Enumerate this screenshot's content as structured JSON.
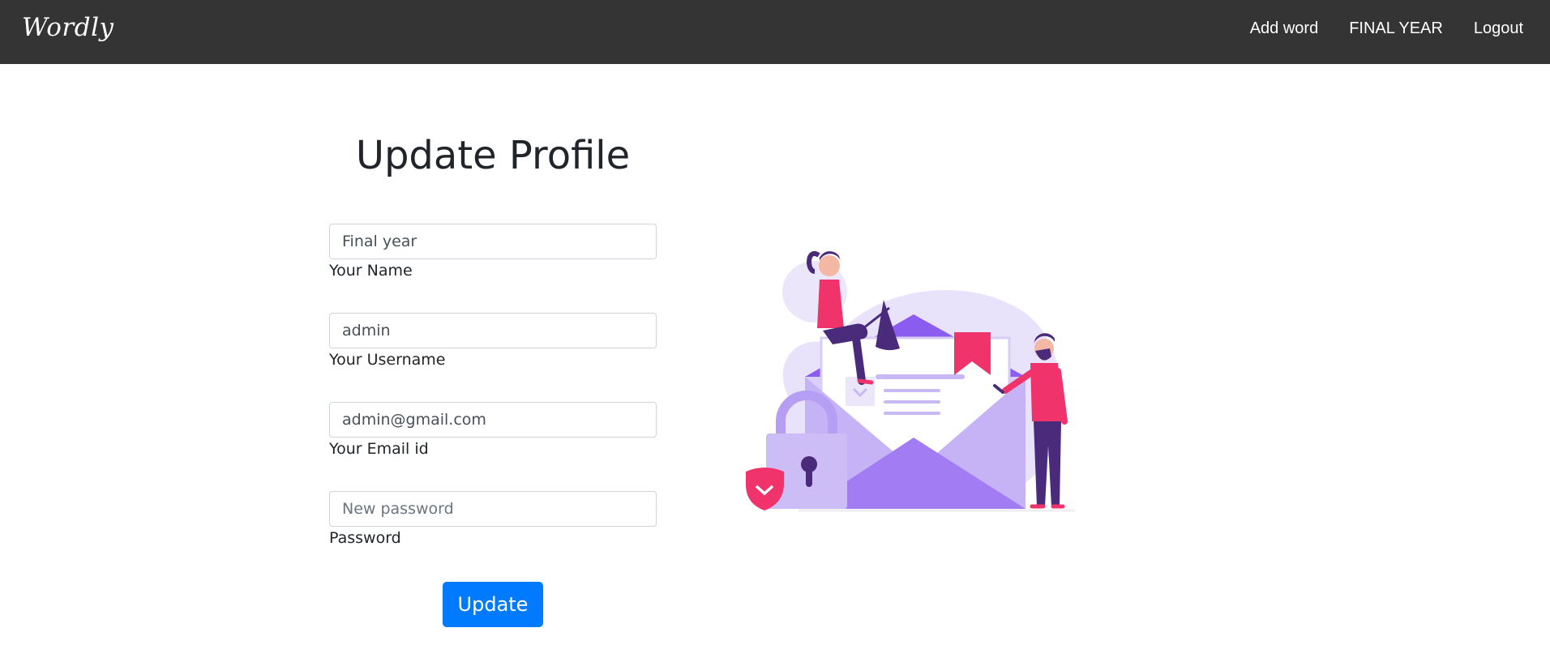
{
  "navbar": {
    "brand": "Wordly",
    "links": [
      {
        "label": "Add word"
      },
      {
        "label": "FINAL YEAR"
      },
      {
        "label": "Logout"
      }
    ]
  },
  "form": {
    "title": "Update Profile",
    "fields": {
      "name": {
        "value": "Final year",
        "label": "Your Name"
      },
      "username": {
        "value": "admin",
        "label": "Your Username"
      },
      "email": {
        "value": "admin@gmail.com",
        "label": "Your Email id"
      },
      "password": {
        "value": "",
        "placeholder": "New password",
        "label": "Password"
      }
    },
    "submit_label": "Update"
  },
  "illustration": {
    "icons": [
      "envelope-icon",
      "lock-icon",
      "shield-icon",
      "bookmark-icon"
    ]
  },
  "colors": {
    "navbar_bg": "#343434",
    "primary": "#007bff",
    "accent_pink": "#f0336b",
    "accent_purple": "#9a6bf5"
  }
}
